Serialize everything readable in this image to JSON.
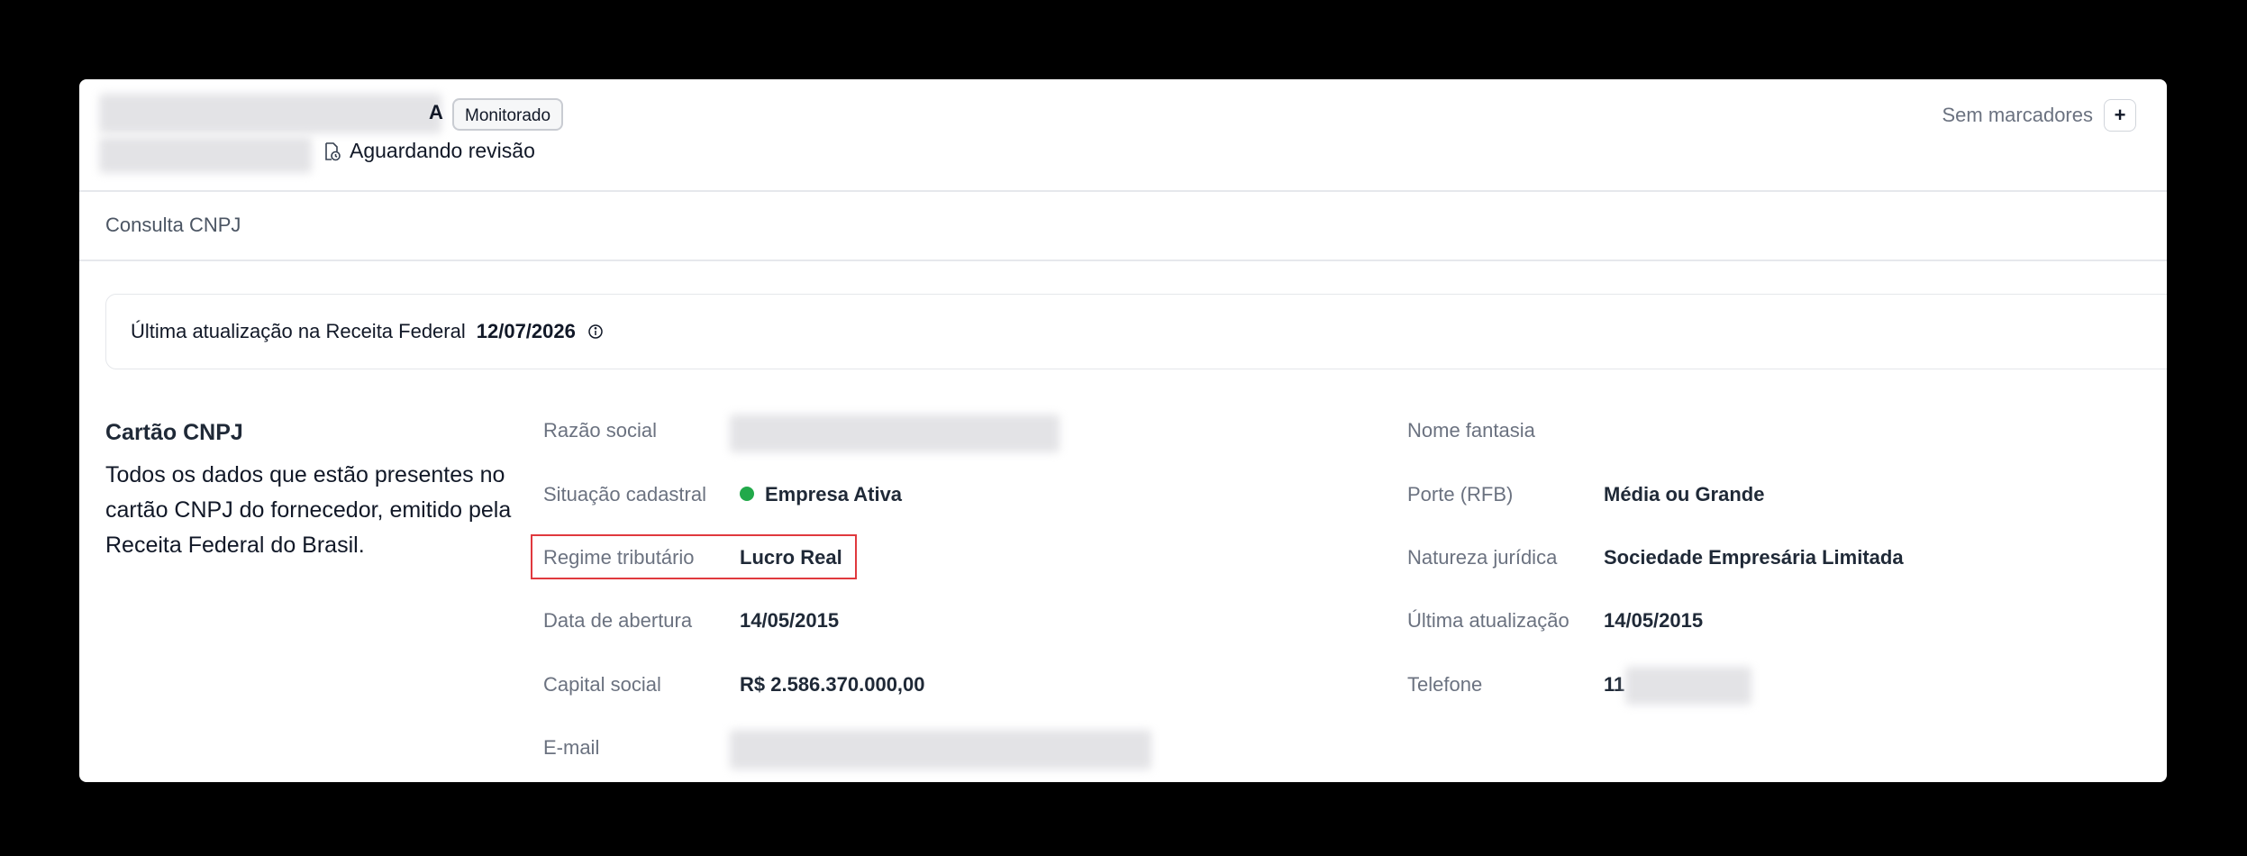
{
  "header": {
    "name_suffix": "A",
    "badge": "Monitorado",
    "review_status": "Aguardando revisão",
    "markers_label": "Sem marcadores",
    "add_label": "+"
  },
  "section": {
    "title": "Consulta CNPJ"
  },
  "update": {
    "label": "Última atualização na Receita Federal",
    "date": "12/07/2026"
  },
  "card": {
    "title": "Cartão CNPJ",
    "description": "Todos os dados que estão presentes no cartão CNPJ do fornecedor, emitido pela Receita Federal do Brasil."
  },
  "fields_left": [
    {
      "label": "Razão social",
      "value": ""
    },
    {
      "label": "Situação cadastral",
      "value": "Empresa Ativa"
    },
    {
      "label": "Regime tributário",
      "value": "Lucro Real"
    },
    {
      "label": "Data de abertura",
      "value": "14/05/2015"
    },
    {
      "label": "Capital social",
      "value": "R$ 2.586.370.000,00"
    },
    {
      "label": "E-mail",
      "value": ""
    }
  ],
  "fields_right": [
    {
      "label": "Nome fantasia",
      "value": ""
    },
    {
      "label": "Porte (RFB)",
      "value": "Média ou Grande"
    },
    {
      "label": "Natureza jurídica",
      "value": "Sociedade Empresária Limitada"
    },
    {
      "label": "Última atualização",
      "value": "14/05/2015"
    },
    {
      "label": "Telefone",
      "value": "11"
    }
  ],
  "colors": {
    "status_active": "#22a94a",
    "highlight": "#e0393e"
  }
}
